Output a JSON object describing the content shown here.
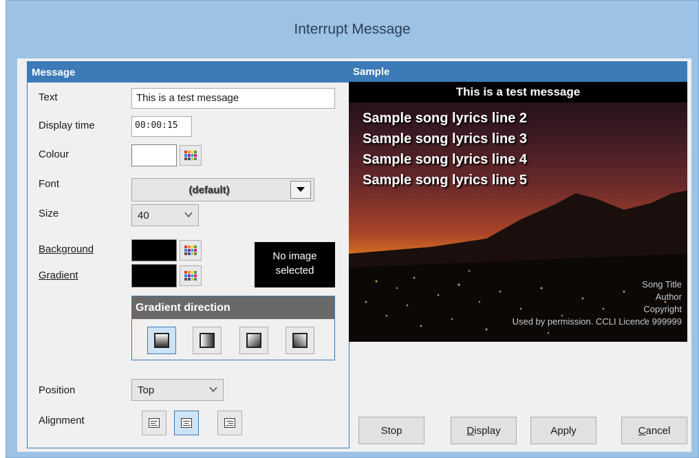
{
  "window": {
    "title": "Interrupt Message"
  },
  "message_panel": {
    "header": "Message",
    "text_label": "Text",
    "text_value": "This is a test message",
    "display_time_label": "Display time",
    "display_time_value": "00:00:15",
    "colour_label": "Colour",
    "colour_value": "#ffffff",
    "font_label": "Font",
    "font_value": "(default)",
    "size_label": "Size",
    "size_value": "40",
    "background_label": "Background",
    "background_color": "#000000",
    "gradient_label": "Gradient",
    "gradient_color": "#000000",
    "no_image_line1": "No image",
    "no_image_line2": "selected",
    "gradient_direction_header": "Gradient direction",
    "position_label": "Position",
    "position_value": "Top",
    "alignment_label": "Alignment"
  },
  "sample_panel": {
    "header": "Sample",
    "message": "This is a test message",
    "lyrics": [
      "Sample song lyrics line 2",
      "Sample song lyrics line 3",
      "Sample song lyrics line 4",
      "Sample song lyrics line 5"
    ],
    "song_title": "Song Title",
    "author": "Author",
    "copyright": "Copyright",
    "licence": "Used by permission. CCLI Licence 999999"
  },
  "buttons": {
    "stop": "Stop",
    "display_u": "D",
    "display_rest": "isplay",
    "apply": "Apply",
    "cancel_u": "C",
    "cancel_rest": "ancel"
  },
  "icons": {
    "palette": "palette-icon",
    "dropdown": "chevron-down-icon",
    "align_left": "align-left-icon",
    "align_center": "align-center-icon",
    "align_right": "align-right-icon"
  },
  "colors": {
    "accent": "#3d7ab8",
    "title_bar": "#9cc3e6",
    "selected_button": "#cde4f7"
  }
}
